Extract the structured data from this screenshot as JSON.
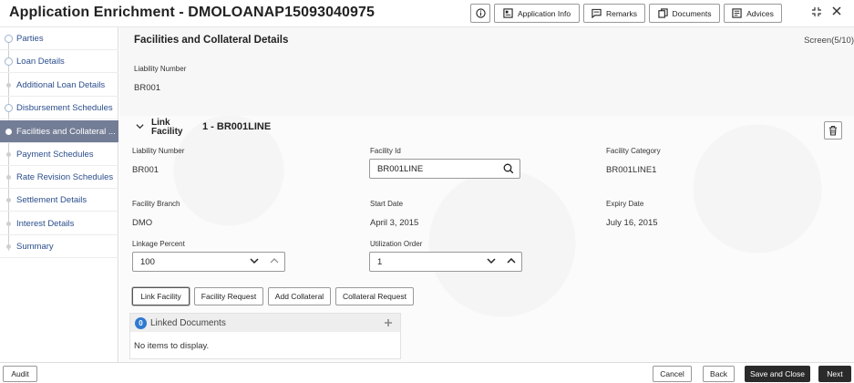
{
  "header": {
    "title": "Application Enrichment - DMOLOANAP15093040975",
    "buttons": {
      "application_info": "Application Info",
      "remarks": "Remarks",
      "documents": "Documents",
      "advices": "Advices"
    }
  },
  "sidebar": {
    "items": [
      {
        "label": "Parties"
      },
      {
        "label": "Loan Details"
      },
      {
        "label": "Additional Loan Details"
      },
      {
        "label": "Disbursement Schedules"
      },
      {
        "label": "Facilities and Collateral ..."
      },
      {
        "label": "Payment Schedules"
      },
      {
        "label": "Rate Revision Schedules"
      },
      {
        "label": "Settlement Details"
      },
      {
        "label": "Interest Details"
      },
      {
        "label": "Summary"
      }
    ]
  },
  "main": {
    "title": "Facilities and Collateral Details",
    "screen_count": "Screen(5/10)",
    "liability_number_label": "Liability Number",
    "liability_number_value": "BR001",
    "link_facility": {
      "label_line1": "Link",
      "label_line2": "Facility",
      "name": "1 - BR001LINE",
      "fields": {
        "liability_number_label": "Liability Number",
        "liability_number_value": "BR001",
        "facility_id_label": "Facility Id",
        "facility_id_value": "BR001LINE",
        "facility_category_label": "Facility Category",
        "facility_category_value": "BR001LINE1",
        "facility_branch_label": "Facility Branch",
        "facility_branch_value": "DMO",
        "start_date_label": "Start Date",
        "start_date_value": "April 3, 2015",
        "expiry_date_label": "Expiry Date",
        "expiry_date_value": "July 16, 2015",
        "linkage_percent_label": "Linkage Percent",
        "linkage_percent_value": "100",
        "utilization_order_label": "Utilization Order",
        "utilization_order_value": "1"
      }
    },
    "tab_buttons": {
      "link_facility": "Link Facility",
      "facility_request": "Facility Request",
      "add_collateral": "Add Collateral",
      "collateral_request": "Collateral Request"
    },
    "linked_documents": {
      "count": "0",
      "title": "Linked Documents",
      "empty_text": "No items to display."
    }
  },
  "footer": {
    "audit": "Audit",
    "cancel": "Cancel",
    "back": "Back",
    "save_close": "Save and Close",
    "next": "Next"
  },
  "colors": {
    "active_sidebar": "#737d96",
    "link_text": "#2b4e8c",
    "badge": "#2f7ad1",
    "primary_button": "#2a2a2a"
  }
}
